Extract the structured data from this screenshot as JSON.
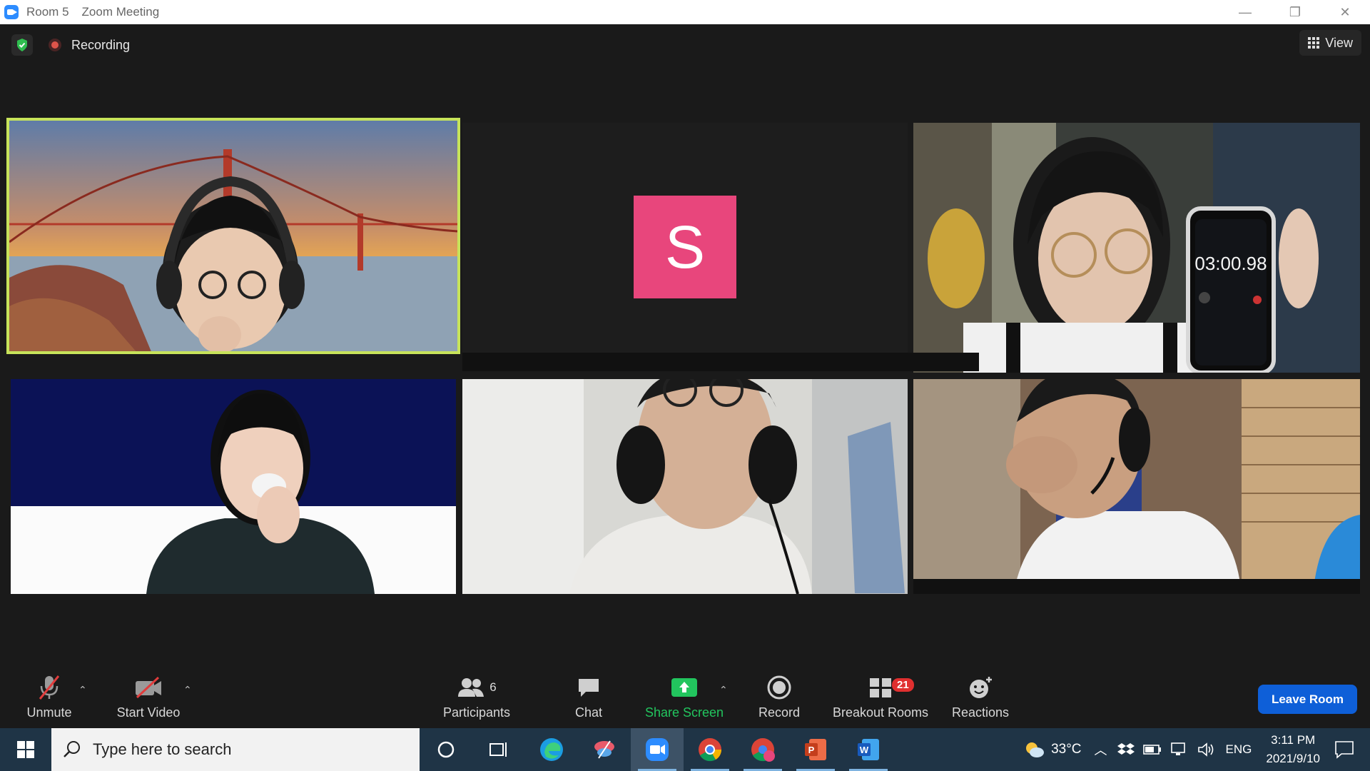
{
  "window": {
    "room": "Room 5",
    "title": "Zoom Meeting"
  },
  "topbar": {
    "recording_label": "Recording",
    "view_label": "View"
  },
  "tiles": [
    {
      "kind": "video",
      "description_icon": "person-headphones-golden-gate-background"
    },
    {
      "kind": "avatar",
      "initial": "S",
      "color": "#e8467c"
    },
    {
      "kind": "video",
      "description_icon": "person-holding-phone-timer",
      "timer_text": "03:00.98"
    },
    {
      "kind": "video",
      "description_icon": "person-smiling-blue-background"
    },
    {
      "kind": "video",
      "description_icon": "person-headphones-ceiling"
    },
    {
      "kind": "video",
      "description_icon": "person-headset-laughing"
    }
  ],
  "toolbar": {
    "unmute_label": "Unmute",
    "start_video_label": "Start Video",
    "participants_label": "Participants",
    "participants_count": "6",
    "chat_label": "Chat",
    "share_screen_label": "Share Screen",
    "record_label": "Record",
    "breakout_rooms_label": "Breakout Rooms",
    "breakout_rooms_badge": "21",
    "reactions_label": "Reactions",
    "leave_room_label": "Leave Room"
  },
  "taskbar": {
    "search_placeholder": "Type here to search",
    "apps": [
      "cortana-icon",
      "task-view-icon",
      "edge-icon",
      "snip-icon",
      "zoom-icon",
      "chrome-icon",
      "chrome-profile-icon",
      "powerpoint-icon",
      "word-icon"
    ],
    "weather": "33°C",
    "language": "ENG",
    "time": "3:11 PM",
    "date": "2021/9/10"
  },
  "colors": {
    "active_speaker": "#c7e35a",
    "share_green": "#22c55e",
    "leave_blue": "#0e5fd8",
    "avatar_pink": "#e8467c"
  }
}
